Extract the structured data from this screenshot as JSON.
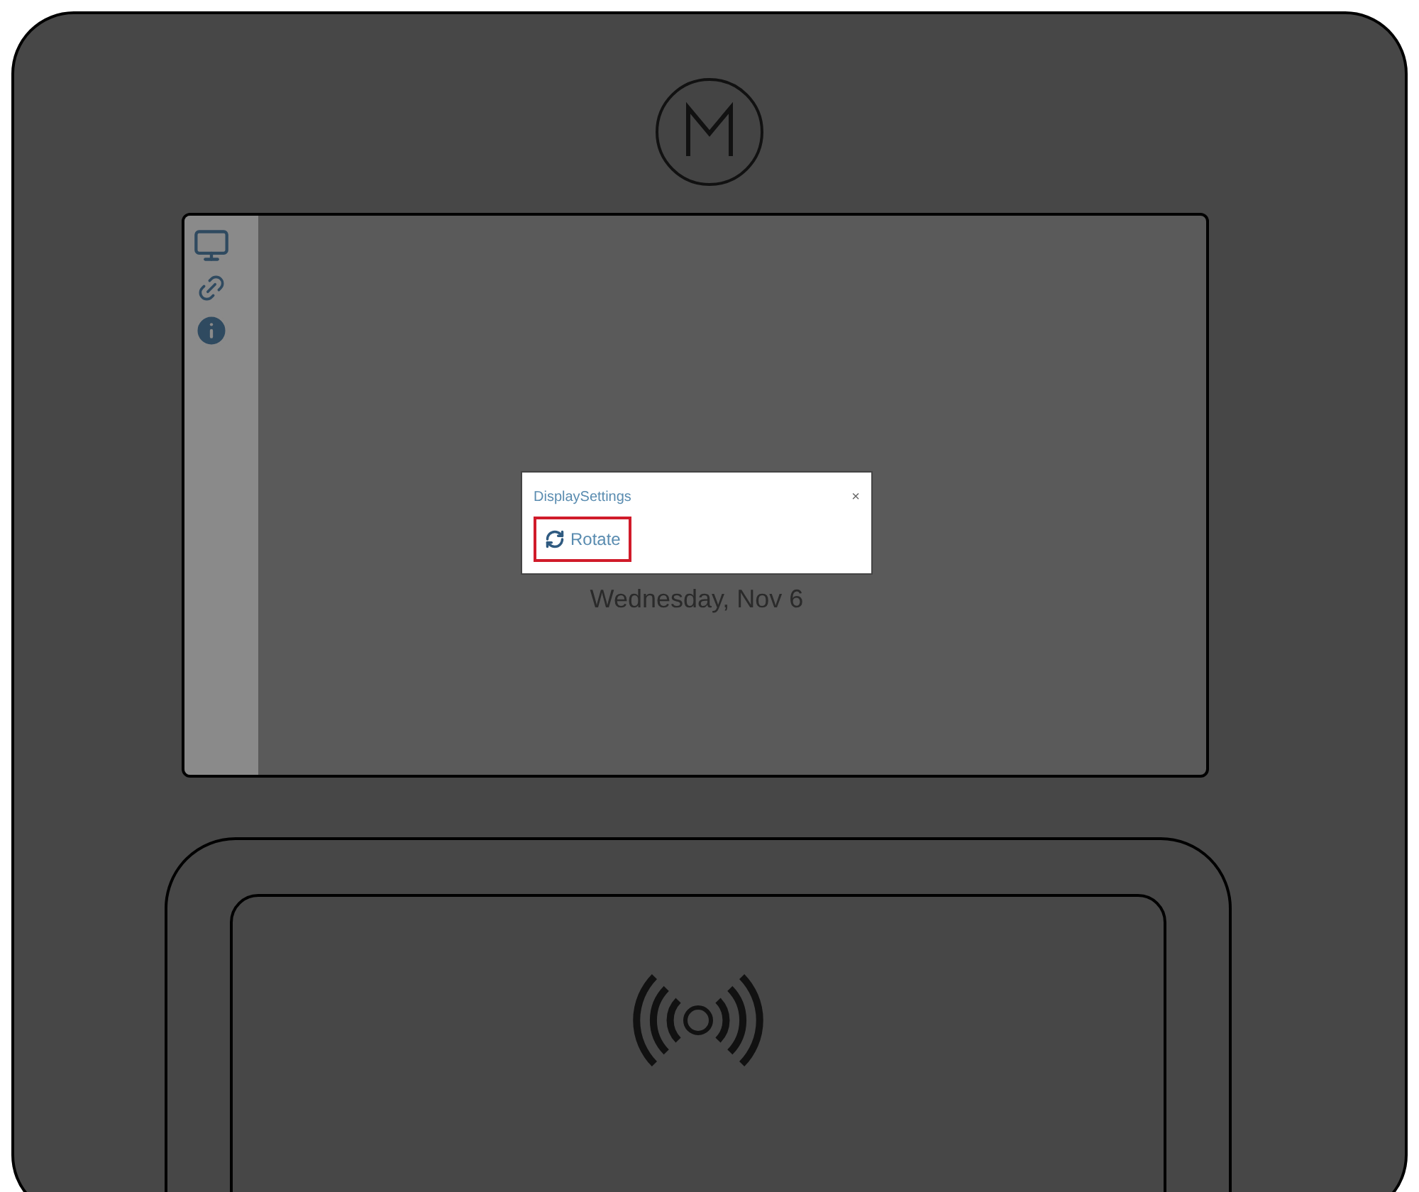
{
  "screen": {
    "background_text": "Wednesday, Nov 6",
    "dialog": {
      "title": "DisplaySettings",
      "close": "×",
      "buttons": [
        {
          "label": "Rotate",
          "focused": true
        }
      ]
    }
  }
}
